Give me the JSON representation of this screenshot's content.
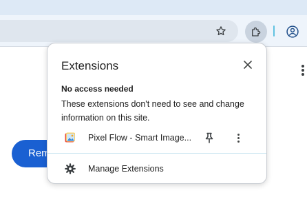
{
  "browser": {
    "toolbar_icons": [
      "star-icon",
      "puzzle-icon",
      "profile-icon"
    ],
    "page_menu_icon": "kebab-icon"
  },
  "page": {
    "primary_button_label": "Rem"
  },
  "extensions_popup": {
    "title": "Extensions",
    "close_icon": "close-icon",
    "section_heading": "No access needed",
    "section_description": "These extensions don't need to see and change information on this site.",
    "extensions": [
      {
        "name": "Pixel Flow - Smart Image...",
        "icon": "pixel-flow-logo",
        "pin_icon": "pin-icon",
        "more_icon": "more-vert-icon"
      }
    ],
    "manage_label": "Manage Extensions",
    "manage_icon": "gear-icon"
  },
  "colors": {
    "accent": "#1a60d2",
    "toolbar_bg": "#eef4fb",
    "titlebar_bg": "#dde9f6"
  }
}
